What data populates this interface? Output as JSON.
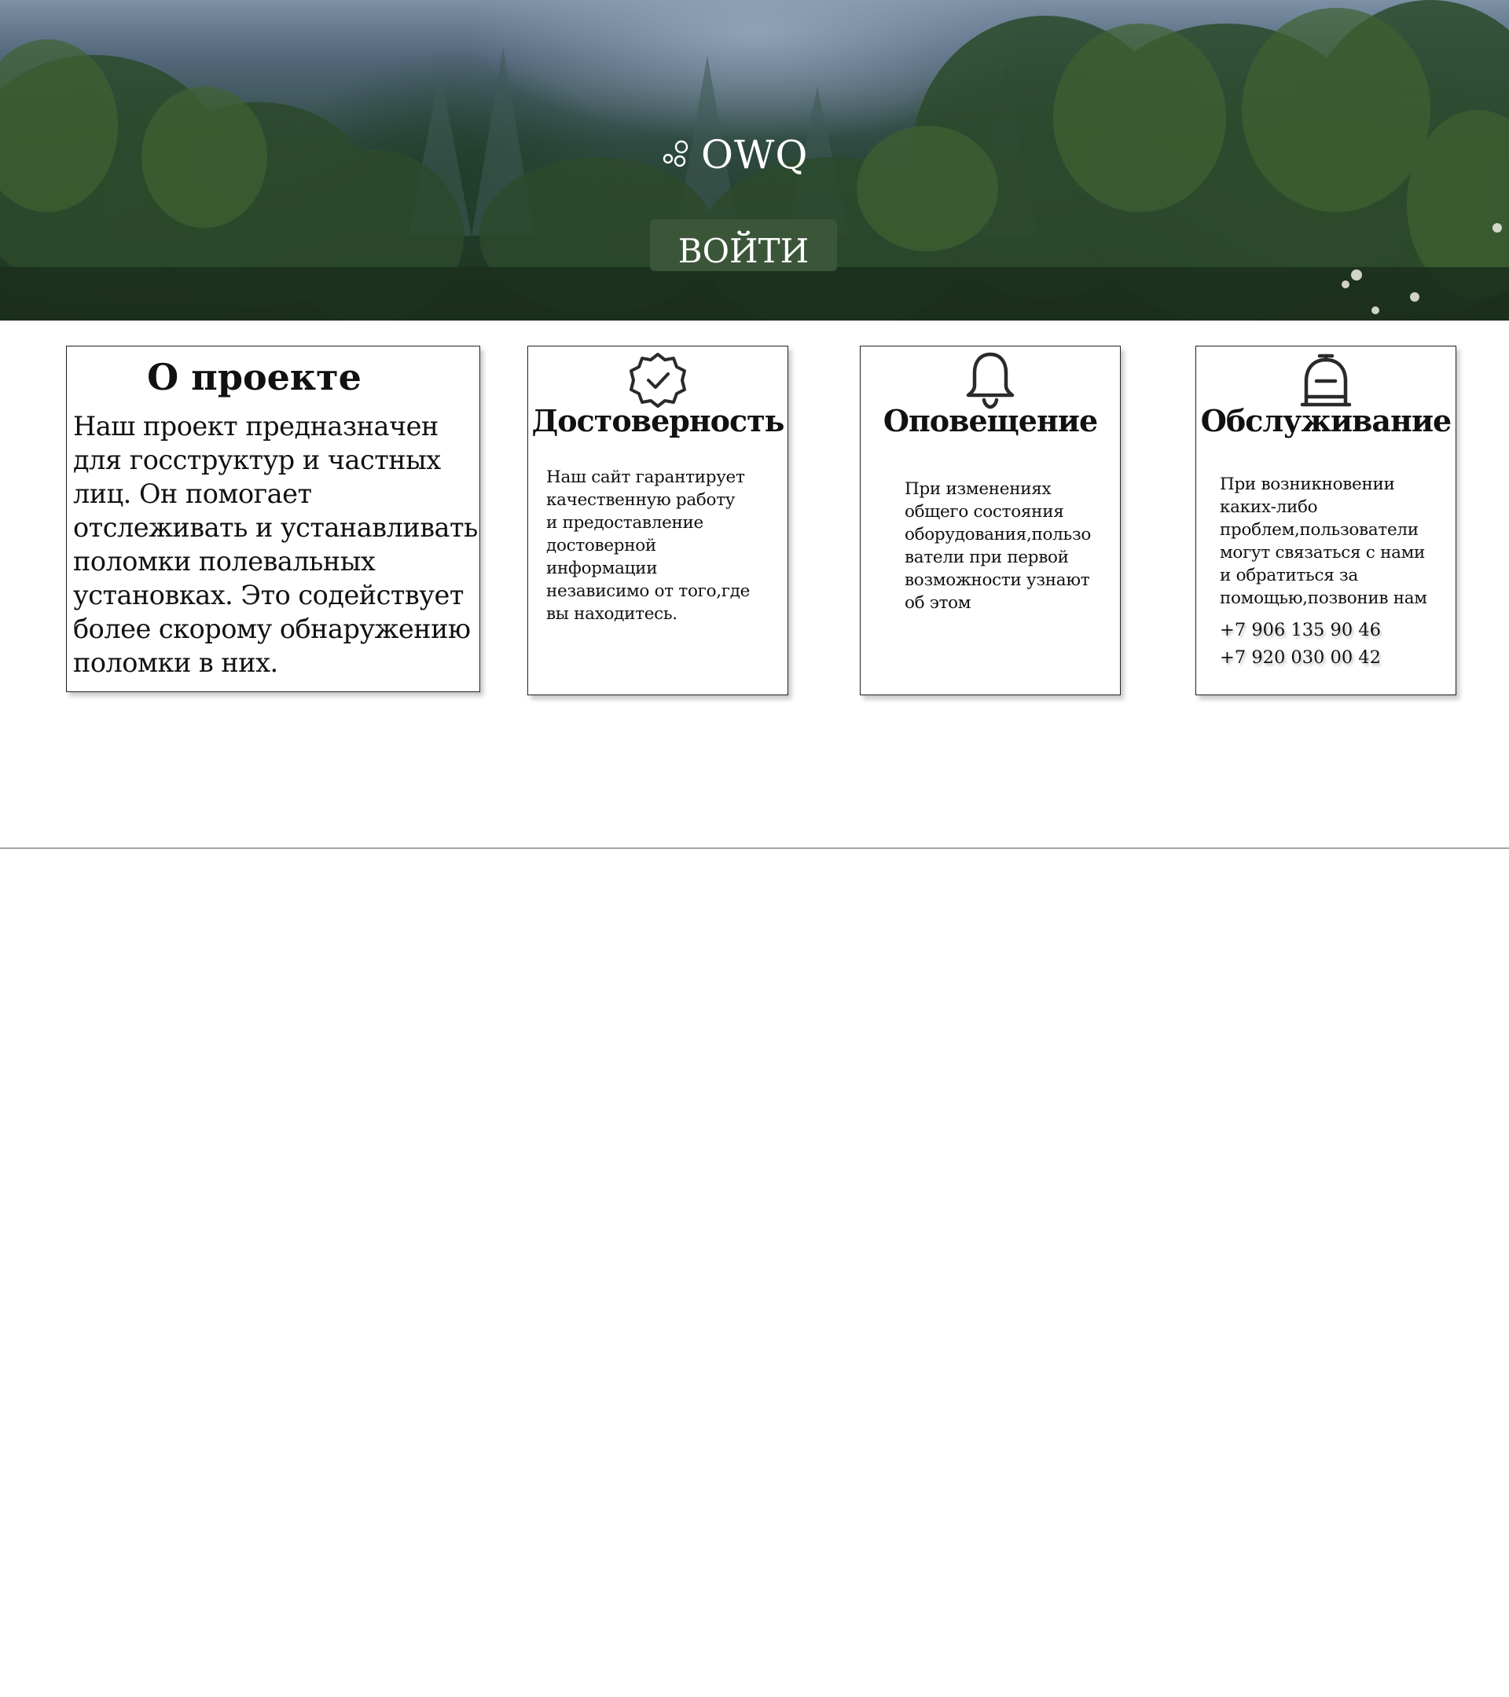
{
  "header": {
    "brand": "OWQ",
    "logo_icon": "bubbles-icon",
    "login_label": "ВОЙТИ",
    "colors": {
      "login_button": "#3b5538",
      "text": "#ffffff"
    }
  },
  "about": {
    "title": "О проекте",
    "text": "Наш проект предназначен\nдля госструктур и частных\nлиц. Он помогает\nотслеживать и устанавливать\nполомки  полевальных\nустановках. Это содействует\nболее скорому обнаружению\nполомки в них."
  },
  "features": {
    "reliability": {
      "icon": "verified-badge-icon",
      "title": "Достоверность",
      "text": "Наш сайт гарантирует\nкачественную работу\nи предоставление\nдостоверной\nинформации\nнезависимо от того,где\nвы находитесь."
    },
    "notification": {
      "icon": "bell-icon",
      "title": "Оповещение",
      "text": "При  изменениях\nобщего состояния\nоборудования,пользо\nватели при первой\nвозможности узнают\nоб этом"
    },
    "service": {
      "icon": "service-bell-icon",
      "title": "Обслуживание",
      "text": "При возникновении\nкаких-либо\nпроблем,пользователи\nмогут связаться с нами\nи обратиться за\nпомощью,позвонив нам",
      "phone_1": "+7 906 135 90 46",
      "phone_2": "+7 920 030 00 42"
    }
  }
}
